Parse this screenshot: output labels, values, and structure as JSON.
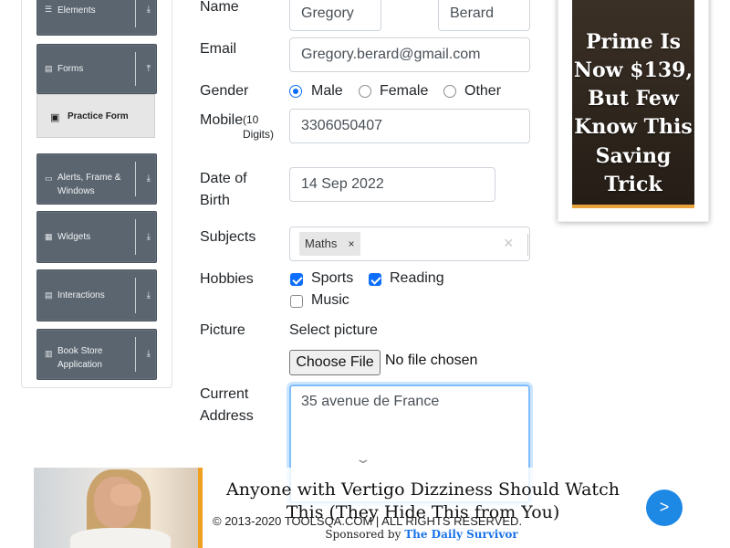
{
  "sidebar": {
    "groups": [
      {
        "label": "Elements",
        "icon": "list-icon"
      },
      {
        "label": "Forms",
        "icon": "form-icon"
      },
      {
        "label": "Alerts, Frame & Windows",
        "icon": "window-icon"
      },
      {
        "label": "Widgets",
        "icon": "grid-icon"
      },
      {
        "label": "Interactions",
        "icon": "interaction-icon"
      },
      {
        "label": "Book Store Application",
        "icon": "bookstore-icon"
      }
    ],
    "subitem": {
      "label": "Practice Form",
      "icon": "form-icon"
    }
  },
  "form": {
    "name_label": "Name",
    "first_name": "Gregory",
    "last_name": "Berard",
    "email_label": "Email",
    "email": "Gregory.berard@gmail.com",
    "gender_label": "Gender",
    "gender_options": [
      "Male",
      "Female",
      "Other"
    ],
    "gender_selected": "Male",
    "mobile_label": "Mobile",
    "mobile_hint": "(10 Digits)",
    "mobile": "3306050407",
    "dob_label": "Date of Birth",
    "dob": "14 Sep 2022",
    "subjects_label": "Subjects",
    "subjects": [
      "Maths"
    ],
    "subject_remove": "×",
    "subjects_clear": "×",
    "hobbies_label": "Hobbies",
    "hobbies": [
      {
        "label": "Sports",
        "checked": true
      },
      {
        "label": "Reading",
        "checked": true
      },
      {
        "label": "Music",
        "checked": false
      }
    ],
    "picture_label": "Picture",
    "picture_select": "Select picture",
    "file_button": "Choose File",
    "file_status": "No file chosen",
    "address_label": "Current Address",
    "address": "35 avenue de France"
  },
  "side_ad": {
    "lines": [
      "Prime Is",
      "Now $139,",
      "But Few",
      "Know This",
      "Saving",
      "Trick"
    ]
  },
  "footer": {
    "text": "© 2013-2020 TOOLSQA.COM | ALL RIGHTS RESERVED."
  },
  "bottom_ad": {
    "title": "Anyone with Vertigo Dizziness Should Watch This (They Hide This from You)",
    "sponsored_prefix": "Sponsored by",
    "sponsor": "The Daily Survivor",
    "next": ">"
  },
  "colors": {
    "accent": "#0d6efd",
    "sidebar_group": "#5a6570",
    "ad_bar": "#f0a020",
    "ad_next": "#1e88e5"
  }
}
